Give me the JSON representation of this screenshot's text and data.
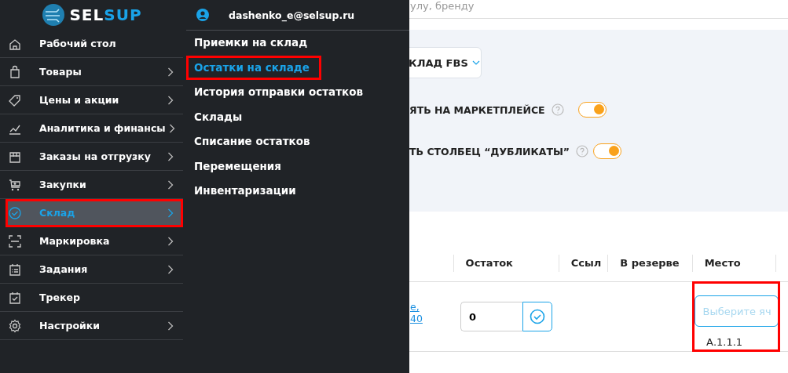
{
  "logo": {
    "part_1": "SEL",
    "part_2": "SUP"
  },
  "sidebar": {
    "items": [
      {
        "label": "Рабочий стол",
        "chevron": false,
        "selected": false,
        "highlighted": false
      },
      {
        "label": "Товары",
        "chevron": true,
        "selected": false,
        "highlighted": false
      },
      {
        "label": "Цены и акции",
        "chevron": true,
        "selected": false,
        "highlighted": false
      },
      {
        "label": "Аналитика и финансы",
        "chevron": true,
        "selected": false,
        "highlighted": false
      },
      {
        "label": "Заказы на отгрузку",
        "chevron": true,
        "selected": false,
        "highlighted": false
      },
      {
        "label": "Закупки",
        "chevron": true,
        "selected": false,
        "highlighted": false
      },
      {
        "label": "Склад",
        "chevron": true,
        "selected": true,
        "highlighted": true
      },
      {
        "label": "Маркировка",
        "chevron": true,
        "selected": false,
        "highlighted": false
      },
      {
        "label": "Задания",
        "chevron": true,
        "selected": false,
        "highlighted": false
      },
      {
        "label": "Трекер",
        "chevron": false,
        "selected": false,
        "highlighted": false
      },
      {
        "label": "Настройки",
        "chevron": true,
        "selected": false,
        "highlighted": false
      }
    ]
  },
  "submenu": {
    "user": "dashenko_e@selsup.ru",
    "items": [
      {
        "label": "Приемки на склад",
        "selected": false,
        "highlighted": false
      },
      {
        "label": "Остатки на складе",
        "selected": true,
        "highlighted": true
      },
      {
        "label": "История отправки остатков",
        "selected": false,
        "highlighted": false
      },
      {
        "label": "Склады",
        "selected": false,
        "highlighted": false
      },
      {
        "label": "Списание остатков",
        "selected": false,
        "highlighted": false
      },
      {
        "label": "Перемещения",
        "selected": false,
        "highlighted": false
      },
      {
        "label": "Инвентаризации",
        "selected": false,
        "highlighted": false
      }
    ]
  },
  "search": {
    "placeholder": "улу, бренду"
  },
  "filters": {
    "warehouse": "КЛАД FBS",
    "toggles": [
      {
        "label": "ЯТЬ НА МАРКЕТПЛЕЙСЕ",
        "on": true
      },
      {
        "label": "ТЬ СТОЛБЕЦ “ДУБЛИКАТЫ”",
        "on": true
      }
    ]
  },
  "table": {
    "columns": [
      "Остаток",
      "Ссыл",
      "В резерве",
      "Место"
    ],
    "rows": [
      {
        "link": "е,\n40",
        "stock": "0",
        "place_placeholder": "Выберите яч",
        "place_option": "А.1.1.1",
        "place_highlighted": true
      }
    ]
  }
}
